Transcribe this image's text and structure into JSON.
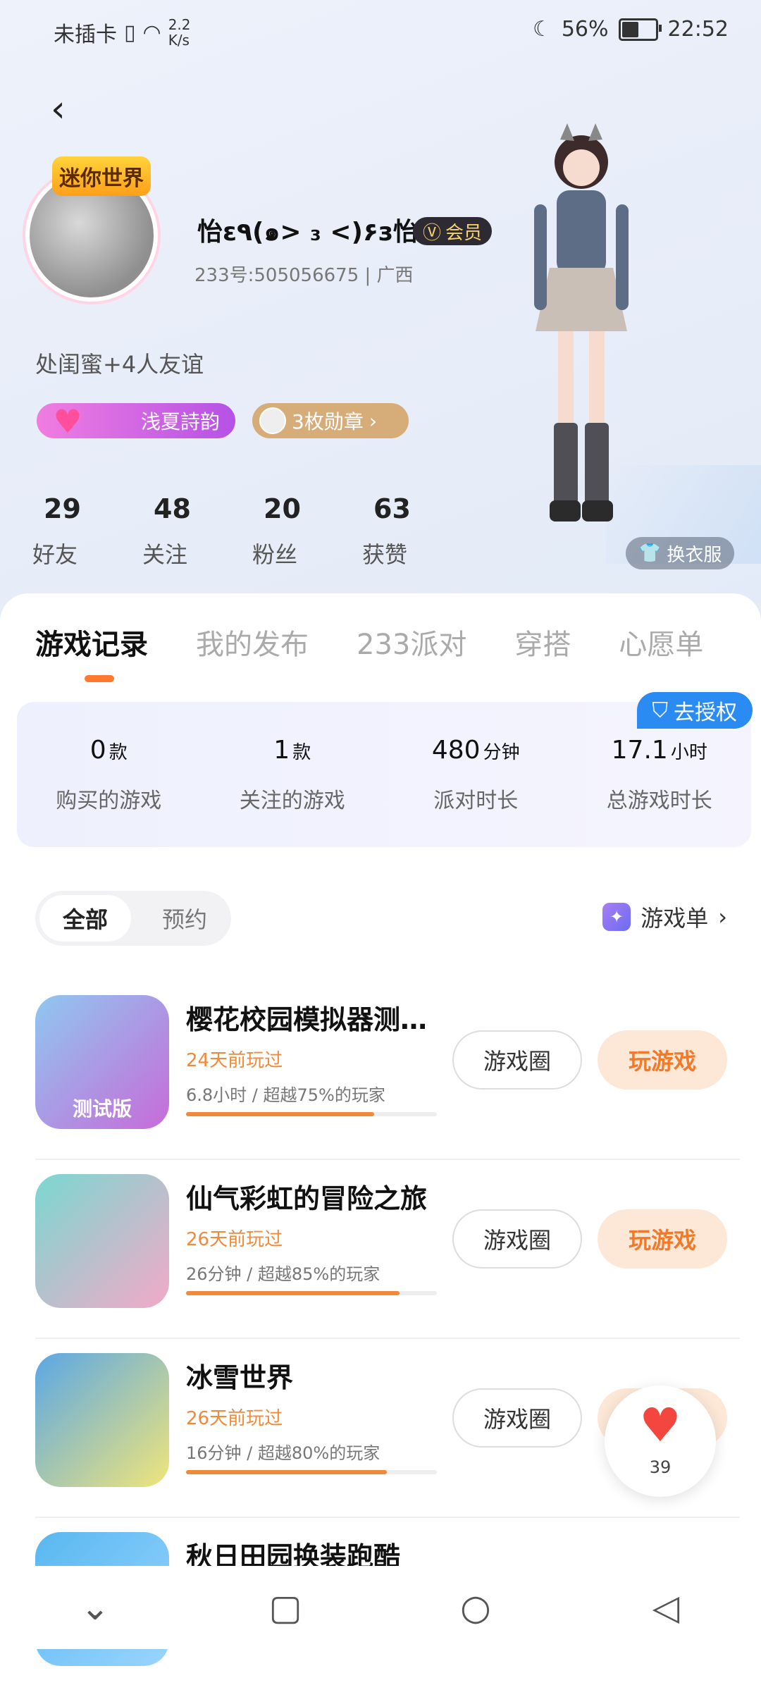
{
  "status": {
    "carrier": "未插卡",
    "speed_value": "2.2",
    "speed_unit": "K/s",
    "battery": "56%",
    "battery_level": 0.56,
    "time": "22:52"
  },
  "profile": {
    "avatar_frame_text": "迷你世界",
    "nickname": "怡ε٩(๑> ₃ <)۶з怡",
    "vip_label": "会员",
    "uid": "233号:505056675 | 广西",
    "bio": "处闺蜜+4人友谊",
    "badge_friend": "浅夏詩韵",
    "badge_medals": "3枚勋章",
    "outfit_button": "换衣服"
  },
  "stats": [
    {
      "value": "29",
      "label": "好友"
    },
    {
      "value": "48",
      "label": "关注"
    },
    {
      "value": "20",
      "label": "粉丝"
    },
    {
      "value": "63",
      "label": "获赞"
    }
  ],
  "tabs": [
    "游戏记录",
    "我的发布",
    "233派对",
    "穿搭",
    "心愿单"
  ],
  "authorize": "去授权",
  "panel": [
    {
      "value": "0",
      "unit": "款",
      "label": "购买的游戏"
    },
    {
      "value": "1",
      "unit": "款",
      "label": "关注的游戏"
    },
    {
      "value": "480",
      "unit": "分钟",
      "label": "派对时长"
    },
    {
      "value": "17.1",
      "unit": "小时",
      "label": "总游戏时长"
    }
  ],
  "filter": {
    "all": "全部",
    "reserve": "预约",
    "gamelist": "游戏单"
  },
  "games": [
    {
      "name": "樱花校园模拟器测…",
      "played": "24天前玩过",
      "meta": "6.8小时 / 超越75%的玩家",
      "progress": 0.75,
      "thumb_text": "测试版",
      "btn_circle": "游戏圈",
      "btn_play": "玩游戏",
      "colors": [
        "#8fc8f0",
        "#c76bd8"
      ]
    },
    {
      "name": "仙气彩虹的冒险之旅",
      "played": "26天前玩过",
      "meta": "26分钟 / 超越85%的玩家",
      "progress": 0.85,
      "thumb_text": "",
      "btn_circle": "游戏圈",
      "btn_play": "玩游戏",
      "colors": [
        "#7ad8d0",
        "#f3a9c8"
      ]
    },
    {
      "name": "冰雪世界",
      "played": "26天前玩过",
      "meta": "16分钟 / 超越80%的玩家",
      "progress": 0.8,
      "thumb_text": "",
      "btn_circle": "游戏圈",
      "btn_play": "玩游戏",
      "colors": [
        "#5aa7e6",
        "#f0e57a"
      ]
    },
    {
      "name": "秋日田园换装跑酷",
      "played": "",
      "meta": "",
      "progress": 0,
      "thumb_text": "",
      "btn_circle": "",
      "btn_play": "",
      "colors": [
        "#58b8f0",
        "#9ad4ff"
      ]
    }
  ],
  "like_count": "39"
}
